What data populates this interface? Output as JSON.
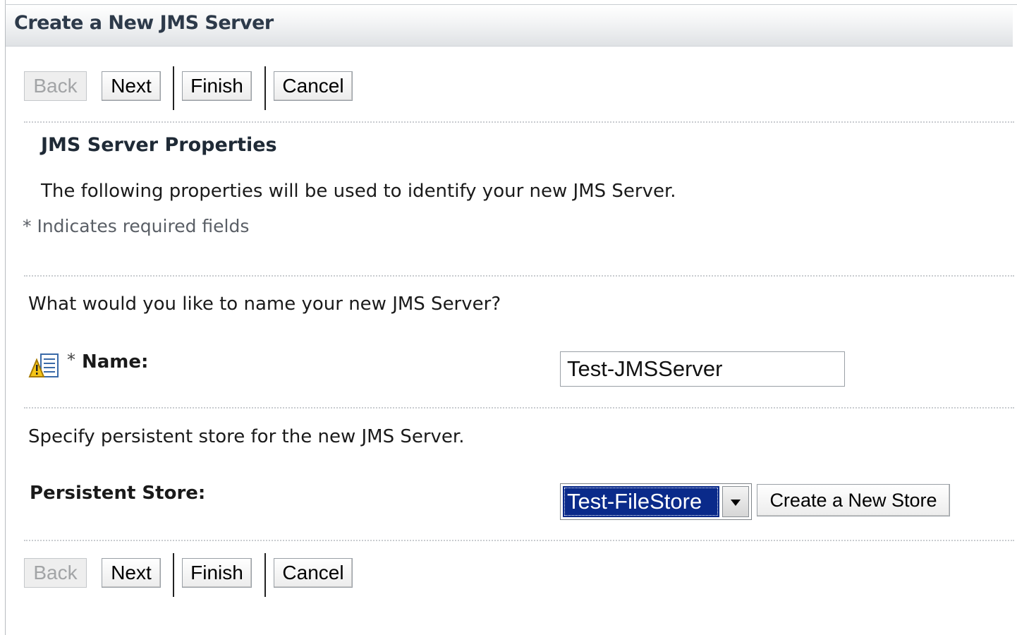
{
  "window": {
    "title": "Create a New JMS Server"
  },
  "top_buttons": {
    "back": "Back",
    "next": "Next",
    "finish": "Finish",
    "cancel": "Cancel"
  },
  "bottom_buttons": {
    "back": "Back",
    "next": "Next",
    "finish": "Finish",
    "cancel": "Cancel"
  },
  "section": {
    "title": "JMS Server Properties",
    "description": "The following properties will be used to identify your new JMS Server.",
    "required_note": "* Indicates required fields"
  },
  "name_block": {
    "question": "What would you like to name your new JMS Server?",
    "required_marker": "*",
    "label": "Name:",
    "value": "Test-JMSServer"
  },
  "store_block": {
    "question": "Specify persistent store for the new JMS Server.",
    "label": "Persistent Store:",
    "selected": "Test-FileStore",
    "create_button": "Create a New Store"
  },
  "icons": {
    "field_info": "warning-form-icon",
    "dropdown": "chevron-down-icon"
  },
  "colors": {
    "selection_bg": "#0a2a8a",
    "title_text": "#2d3a4a"
  }
}
